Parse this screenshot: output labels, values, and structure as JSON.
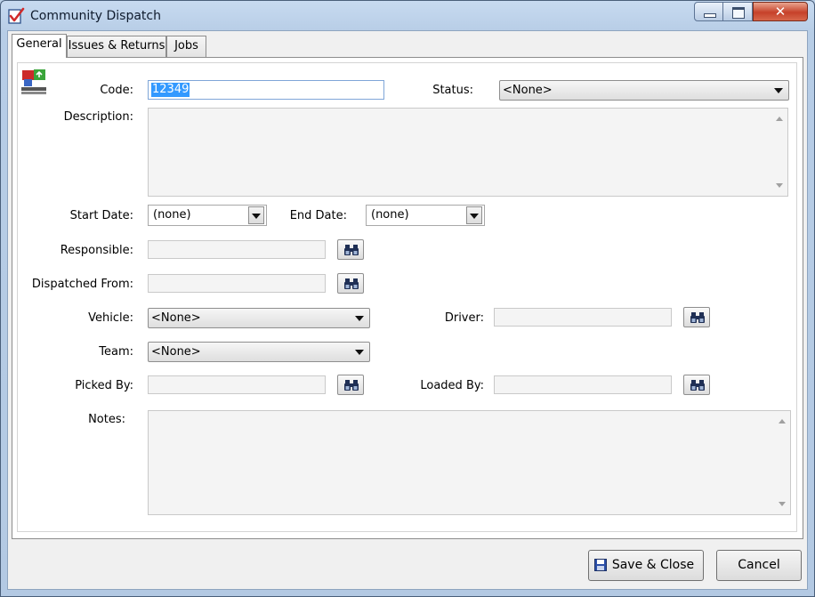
{
  "window": {
    "title": "Community Dispatch",
    "close_glyph": "✕",
    "icon": "app-document-check-icon"
  },
  "tabs": [
    {
      "label": "General",
      "active": true
    },
    {
      "label": "Issues & Returns",
      "active": false
    },
    {
      "label": "Jobs",
      "active": false
    }
  ],
  "form": {
    "record_icon": "dispatch-record-icon",
    "code_label": "Code:",
    "code_value": "12349",
    "status_label": "Status:",
    "status_value": "<None>",
    "description_label": "Description:",
    "description_value": "",
    "start_date_label": "Start Date:",
    "start_date_value": "(none)",
    "end_date_label": "End Date:",
    "end_date_value": "(none)",
    "responsible_label": "Responsible:",
    "responsible_value": "",
    "dispatched_from_label": "Dispatched From:",
    "dispatched_from_value": "",
    "vehicle_label": "Vehicle:",
    "vehicle_value": "<None>",
    "driver_label": "Driver:",
    "driver_value": "",
    "team_label": "Team:",
    "team_value": "<None>",
    "picked_by_label": "Picked By:",
    "picked_by_value": "",
    "loaded_by_label": "Loaded By:",
    "loaded_by_value": "",
    "notes_label": "Notes:",
    "notes_value": ""
  },
  "footer": {
    "save_close_label": "Save & Close",
    "cancel_label": "Cancel"
  },
  "colors": {
    "selection": "#3399ff",
    "title_bar": "#b7cde6",
    "close_button": "#c6412a"
  }
}
